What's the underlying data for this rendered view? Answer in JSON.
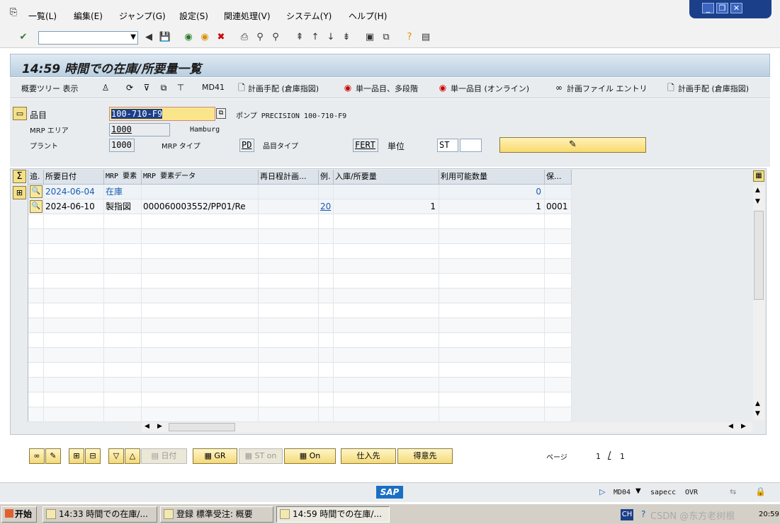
{
  "menu": [
    "一覧(L)",
    "編集(E)",
    "ジャンプ(G)",
    "設定(S)",
    "関連処理(V)",
    "システム(Y)",
    "ヘルプ(H)"
  ],
  "title": "14:59 時間での在庫/所要量一覧",
  "app_toolbar": {
    "tree": "概要ツリー 表示",
    "md41": "MD41",
    "plan1": "計画手配 (倉庫指図)",
    "single_multi": "単一品目、多段階",
    "single_online": "単一品目 (オンライン)",
    "plan_file": "計画ファイル エントリ",
    "plan2": "計画手配 (倉庫指図)"
  },
  "header": {
    "material_label": "品目",
    "material_value": "100-710-F9",
    "material_desc": "ポンプ PRECISION 100-710-F9",
    "mrp_area_label": "MRP エリア",
    "mrp_area_value": "1000",
    "mrp_area_desc": "Hamburg",
    "plant_label": "プラント",
    "plant_value": "1000",
    "mrp_type_label": "MRP タイプ",
    "mrp_type_value": "PD",
    "mat_type_label": "品目タイプ",
    "mat_type_value": "FERT",
    "unit_label": "単位",
    "unit_value": "ST"
  },
  "table": {
    "columns": [
      "追.",
      "所要日付",
      "MRP 要素",
      "MRP 要素データ",
      "再日程計画...",
      "例.",
      "入庫/所要量",
      "利用可能数量",
      "保..."
    ],
    "rows": [
      {
        "date": "2024-06-04",
        "element": "在庫",
        "data": "",
        "resched": "",
        "exc": "",
        "qty": "",
        "avail": "0",
        "stor": ""
      },
      {
        "date": "2024-06-10",
        "element": "製指図",
        "data": "000060003552/PP01/Re",
        "resched": "",
        "exc": "20",
        "qty": "1",
        "avail": "1",
        "stor": "0001"
      }
    ]
  },
  "bottom_buttons": {
    "date": "日付",
    "gr": "GR",
    "st_on": "ST on",
    "on": "On",
    "vendor": "仕入先",
    "customer": "得意先",
    "page_label": "ページ",
    "page_current": "1",
    "page_sep": "/",
    "page_total": "1"
  },
  "status": {
    "logo": "SAP",
    "tcode": "MD04",
    "server": "sapecc",
    "mode": "OVR"
  },
  "taskbar": {
    "start": "开始",
    "tasks": [
      "14:33 時間での在庫/...",
      "登録 標準受注: 概要",
      "14:59 時間での在庫/..."
    ],
    "lang": "CH",
    "watermark": "CSDN @东方老树根",
    "clock": "20:59"
  }
}
